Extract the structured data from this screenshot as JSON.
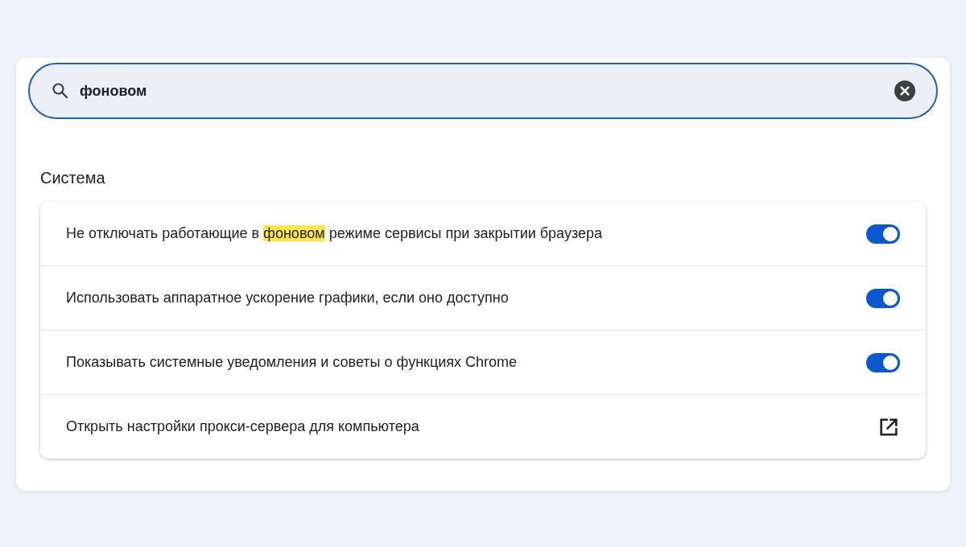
{
  "search": {
    "value": "фоновом"
  },
  "section": {
    "title": "Система"
  },
  "rows": [
    {
      "kind": "toggle",
      "on": true,
      "label": [
        {
          "text": "Не отключать работающие в ",
          "highlighted": false
        },
        {
          "text": "фоновом",
          "highlighted": true
        },
        {
          "text": " режиме сервисы при закрытии браузера",
          "highlighted": false
        }
      ]
    },
    {
      "kind": "toggle",
      "on": true,
      "label": [
        {
          "text": "Использовать аппаратное ускорение графики, если оно доступно",
          "highlighted": false
        }
      ]
    },
    {
      "kind": "toggle",
      "on": true,
      "label": [
        {
          "text": "Показывать системные уведомления и советы о функциях Chrome",
          "highlighted": false
        }
      ]
    },
    {
      "kind": "link",
      "label": [
        {
          "text": "Открыть настройки прокси-сервера для компьютера",
          "highlighted": false
        }
      ]
    }
  ]
}
